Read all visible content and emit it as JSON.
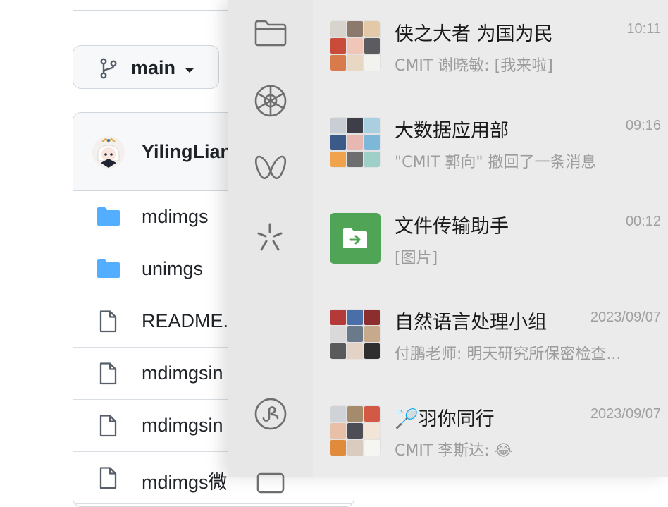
{
  "github": {
    "branch_label": "main",
    "commit_author": "YilingLian",
    "files": [
      {
        "name": "mdimgs",
        "kind": "folder"
      },
      {
        "name": "unimgs",
        "kind": "folder"
      },
      {
        "name": "README.",
        "kind": "file"
      },
      {
        "name": "mdimgsin",
        "kind": "file"
      },
      {
        "name": "mdimgsin",
        "kind": "file"
      },
      {
        "name": "mdimgs微",
        "kind": "file"
      }
    ]
  },
  "wechat": {
    "sidebar_icons": [
      "folder-icon",
      "moments-aperture-icon",
      "channels-icon",
      "search-sparkle-icon",
      "mini-programs-icon"
    ],
    "chats": [
      {
        "name": "侠之大者 为国为民",
        "time": "10:11",
        "preview": "CMIT 谢晓敏: [我来啦]",
        "avatar": "group-grid"
      },
      {
        "name": "大数据应用部",
        "time": "09:16",
        "preview": "\"CMIT 郭向\" 撤回了一条消息",
        "avatar": "group-grid"
      },
      {
        "name": "文件传输助手",
        "time": "00:12",
        "preview": "[图片]",
        "avatar": "file-transfer-icon"
      },
      {
        "name": "自然语言处理小组",
        "time": "2023/09/07",
        "preview": "付鹏老师: 明天研究所保密检查...",
        "avatar": "group-grid"
      },
      {
        "name": "🏸羽你同行",
        "time": "2023/09/07",
        "preview": "CMIT 李斯达: 😂",
        "avatar": "group-grid"
      }
    ]
  },
  "colors": {
    "wechat_sidebar_bg": "#e7e7e7",
    "wechat_list_bg": "#ebebeb",
    "file_transfer_green": "#4fa555",
    "github_folder_blue": "#54aeff"
  }
}
